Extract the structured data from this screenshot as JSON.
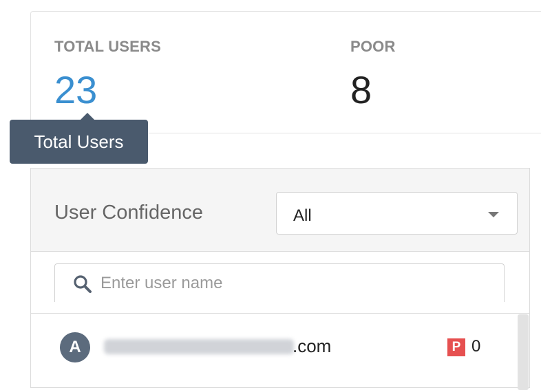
{
  "stats": {
    "total_users": {
      "label": "TOTAL USERS",
      "value": "23",
      "color": "#3a8fd0"
    },
    "poor": {
      "label": "POOR",
      "value": "8",
      "color": "#222222"
    }
  },
  "tooltip": {
    "text": "Total Users"
  },
  "filter": {
    "label": "User Confidence",
    "selected": "All"
  },
  "search": {
    "placeholder": "Enter user name",
    "value": ""
  },
  "users": [
    {
      "avatar_letter": "A",
      "email_suffix": ".com",
      "badge": "P",
      "count": "0",
      "badge_color": "#e65050"
    }
  ]
}
